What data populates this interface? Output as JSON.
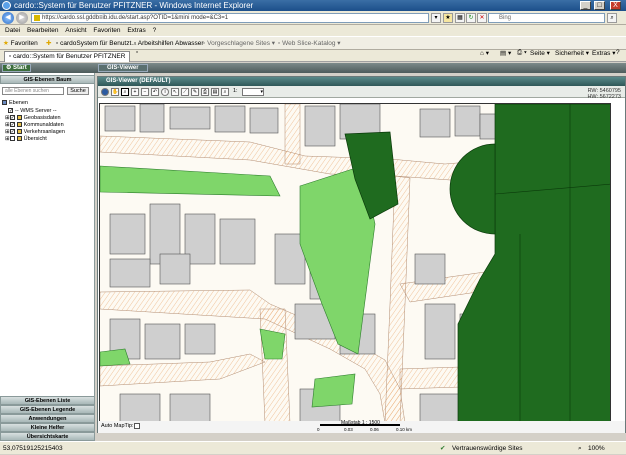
{
  "window": {
    "title": "cardo::System für Benutzer PFITZNER - Windows Internet Explorer",
    "min": "_",
    "max": "□",
    "close": "X"
  },
  "addressbar": {
    "url": "https://cardo.ssl.gddb≡ib.idu.de/start.asp?OTID=1&mini mode=&C3=1",
    "search_placeholder": "Bing"
  },
  "menu": [
    "Datei",
    "Bearbeiten",
    "Ansicht",
    "Favoriten",
    "Extras",
    "?"
  ],
  "favbar": {
    "favoriten": "Favoriten",
    "items": [
      "cardoSystem für Benutzt...",
      "Arbeitshilfen Abwasser",
      "Vorgeschlagene Sites ▾",
      "Web Slice-Katalog ▾"
    ],
    "right_items": [
      "Seite ▾",
      "Sicherheit ▾",
      "Extras ▾",
      "?"
    ]
  },
  "tabs": {
    "active": "cardo::System für Benutzer PFITZNER"
  },
  "appbar": {
    "start": "Start",
    "gis_viewer_btn": "GIS-Viewer"
  },
  "leftpanel": {
    "title": "GIS-Ebenen Baum",
    "search_placeholder": "alle Ebenen suchen",
    "search_btn": "Suche",
    "tree": {
      "root": "Ebenen",
      "items": [
        "-- WMS Server --",
        "Geobasisdaten",
        "Kommunaldaten",
        "Verkehrsanlagen",
        "Übersicht"
      ]
    },
    "bottom_sections": [
      "GIS-Ebenen Liste",
      "GIS-Ebenen Legende",
      "Anwendungen",
      "Kleine Helfer",
      "Übersichtskarte"
    ]
  },
  "viewer": {
    "title": "GIS-Viewer (DEFAULT)",
    "zoom_value": "1:",
    "coords": {
      "rw": "RW: 5460795",
      "hw": "HW: 5672273"
    },
    "auto_maptip": "Auto MapTip:",
    "scale_label": "Maßstab 1 : 1500",
    "scale_ticks": [
      "0",
      "0.03",
      "0.06",
      "0.10 km"
    ]
  },
  "statusbar": {
    "coords": "53,07519125215403",
    "zone": "Vertrauenswürdige Sites",
    "zoom": "100%"
  },
  "colors": {
    "dark_green": "#1f6b1f",
    "light_green": "#7fd66a",
    "building_gray": "#cfcfcf",
    "road_orange": "#e8a060"
  }
}
